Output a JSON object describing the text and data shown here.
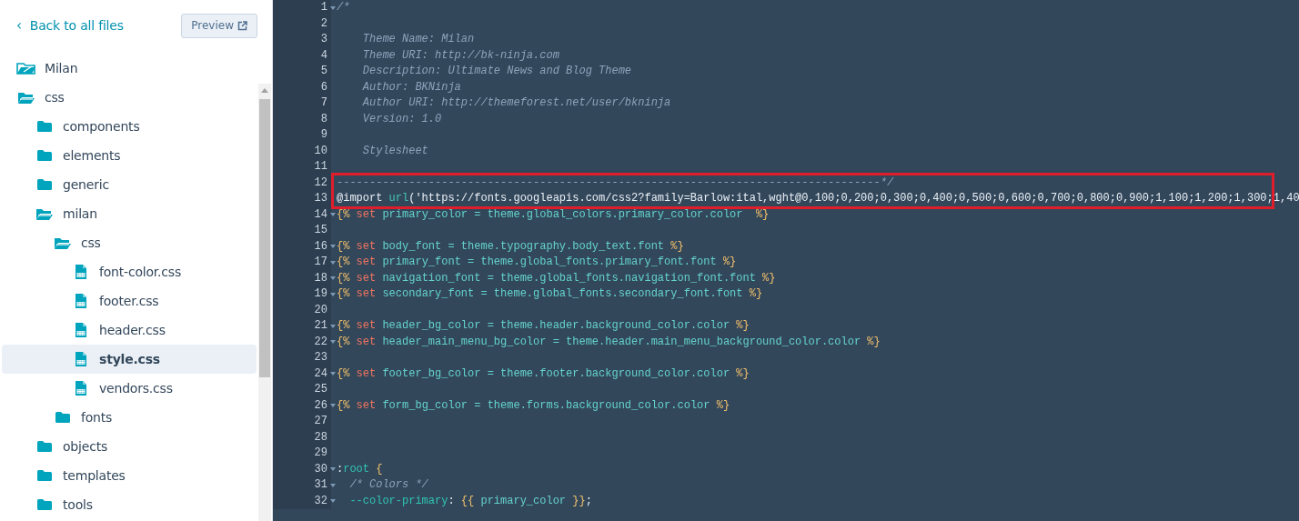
{
  "sidebar": {
    "back_link": {
      "icon": "‹",
      "label": "Back to all files"
    },
    "preview_button": {
      "label": "Preview"
    },
    "tree": [
      {
        "kind": "theme",
        "label": "Milan",
        "selected": false
      },
      {
        "kind": "folder",
        "label": "css",
        "expanded": true,
        "selected": false,
        "children": [
          {
            "kind": "folder",
            "label": "components",
            "expanded": false,
            "selected": false
          },
          {
            "kind": "folder",
            "label": "elements",
            "expanded": false,
            "selected": false
          },
          {
            "kind": "folder",
            "label": "generic",
            "expanded": false,
            "selected": false
          },
          {
            "kind": "folder",
            "label": "milan",
            "expanded": true,
            "selected": false,
            "children": [
              {
                "kind": "folder",
                "label": "css",
                "expanded": true,
                "selected": false,
                "children": [
                  {
                    "kind": "file",
                    "label": "font-color.css",
                    "selected": false
                  },
                  {
                    "kind": "file",
                    "label": "footer.css",
                    "selected": false
                  },
                  {
                    "kind": "file",
                    "label": "header.css",
                    "selected": false
                  },
                  {
                    "kind": "file",
                    "label": "style.css",
                    "selected": true
                  },
                  {
                    "kind": "file",
                    "label": "vendors.css",
                    "selected": false
                  }
                ]
              },
              {
                "kind": "folder",
                "label": "fonts",
                "expanded": false,
                "selected": false
              }
            ]
          },
          {
            "kind": "folder",
            "label": "objects",
            "expanded": false,
            "selected": false
          },
          {
            "kind": "folder",
            "label": "templates",
            "expanded": false,
            "selected": false
          },
          {
            "kind": "folder",
            "label": "tools",
            "expanded": false,
            "selected": false
          }
        ]
      }
    ]
  },
  "editor": {
    "lines": [
      {
        "number": "1",
        "foldable": true,
        "highlighted": false,
        "tokens": [
          {
            "kind": "comment",
            "text": "/*"
          }
        ]
      },
      {
        "number": "2",
        "foldable": false,
        "highlighted": false
      },
      {
        "number": "3",
        "foldable": false,
        "highlighted": false,
        "tokens": [
          {
            "kind": "comment",
            "text": "    Theme Name: Milan"
          }
        ]
      },
      {
        "number": "4",
        "foldable": false,
        "highlighted": false,
        "tokens": [
          {
            "kind": "comment",
            "text": "    Theme URI: http://bk-ninja.com"
          }
        ]
      },
      {
        "number": "5",
        "foldable": false,
        "highlighted": false,
        "tokens": [
          {
            "kind": "comment",
            "text": "    Description: Ultimate News and Blog Theme"
          }
        ]
      },
      {
        "number": "6",
        "foldable": false,
        "highlighted": false,
        "tokens": [
          {
            "kind": "comment",
            "text": "    Author: BKNinja"
          }
        ]
      },
      {
        "number": "7",
        "foldable": false,
        "highlighted": false,
        "tokens": [
          {
            "kind": "comment",
            "text": "    Author URI: http://themeforest.net/user/bkninja"
          }
        ]
      },
      {
        "number": "8",
        "foldable": false,
        "highlighted": false,
        "tokens": [
          {
            "kind": "comment",
            "text": "    Version: 1.0"
          }
        ]
      },
      {
        "number": "9",
        "foldable": false,
        "highlighted": false
      },
      {
        "number": "10",
        "foldable": false,
        "highlighted": false,
        "tokens": [
          {
            "kind": "comment",
            "text": "    Stylesheet"
          }
        ]
      },
      {
        "number": "11",
        "foldable": false,
        "highlighted": false
      },
      {
        "number": "12",
        "foldable": false,
        "highlighted": true,
        "tokens": [
          {
            "kind": "comment",
            "text": "-----------------------------------------------------------------------------------*/"
          }
        ]
      },
      {
        "number": "13",
        "foldable": false,
        "highlighted": true,
        "tokens": [
          {
            "kind": "plain",
            "text": "@import "
          },
          {
            "kind": "func",
            "text": "url"
          },
          {
            "kind": "plain",
            "text": "('https://fonts.googleapis.com/css2?family=Barlow:ital,wght@0,100;0,200;0,300;0,400;0,500;0,600;0,700;0,800;0,900;1,100;1,200;1,300;1,40"
          }
        ]
      },
      {
        "number": "14",
        "foldable": true,
        "highlighted": false,
        "tokens": [
          {
            "kind": "delim",
            "text": "{%"
          },
          {
            "kind": "set",
            "text": " set "
          },
          {
            "kind": "var",
            "text": "primary_color = theme.global_colors.primary_color.color  "
          },
          {
            "kind": "delim",
            "text": "%}"
          }
        ]
      },
      {
        "number": "15",
        "foldable": false,
        "highlighted": false
      },
      {
        "number": "16",
        "foldable": true,
        "highlighted": false,
        "tokens": [
          {
            "kind": "delim",
            "text": "{%"
          },
          {
            "kind": "set",
            "text": " set "
          },
          {
            "kind": "var",
            "text": "body_font = theme.typography.body_text.font "
          },
          {
            "kind": "delim",
            "text": "%}"
          }
        ]
      },
      {
        "number": "17",
        "foldable": true,
        "highlighted": false,
        "tokens": [
          {
            "kind": "delim",
            "text": "{%"
          },
          {
            "kind": "set",
            "text": " set "
          },
          {
            "kind": "var",
            "text": "primary_font = theme.global_fonts.primary_font.font "
          },
          {
            "kind": "delim",
            "text": "%}"
          }
        ]
      },
      {
        "number": "18",
        "foldable": true,
        "highlighted": false,
        "tokens": [
          {
            "kind": "delim",
            "text": "{%"
          },
          {
            "kind": "set",
            "text": " set "
          },
          {
            "kind": "var",
            "text": "navigation_font = theme.global_fonts.navigation_font.font "
          },
          {
            "kind": "delim",
            "text": "%}"
          }
        ]
      },
      {
        "number": "19",
        "foldable": true,
        "highlighted": false,
        "tokens": [
          {
            "kind": "delim",
            "text": "{%"
          },
          {
            "kind": "set",
            "text": " set "
          },
          {
            "kind": "var",
            "text": "secondary_font = theme.global_fonts.secondary_font.font "
          },
          {
            "kind": "delim",
            "text": "%}"
          }
        ]
      },
      {
        "number": "20",
        "foldable": false,
        "highlighted": false
      },
      {
        "number": "21",
        "foldable": true,
        "highlighted": false,
        "tokens": [
          {
            "kind": "delim",
            "text": "{%"
          },
          {
            "kind": "set",
            "text": " set "
          },
          {
            "kind": "var",
            "text": "header_bg_color = theme.header.background_color.color "
          },
          {
            "kind": "delim",
            "text": "%}"
          }
        ]
      },
      {
        "number": "22",
        "foldable": true,
        "highlighted": false,
        "tokens": [
          {
            "kind": "delim",
            "text": "{%"
          },
          {
            "kind": "set",
            "text": " set "
          },
          {
            "kind": "var",
            "text": "header_main_menu_bg_color = theme.header.main_menu_background_color.color "
          },
          {
            "kind": "delim",
            "text": "%}"
          }
        ]
      },
      {
        "number": "23",
        "foldable": false,
        "highlighted": false
      },
      {
        "number": "24",
        "foldable": true,
        "highlighted": false,
        "tokens": [
          {
            "kind": "delim",
            "text": "{%"
          },
          {
            "kind": "set",
            "text": " set "
          },
          {
            "kind": "var",
            "text": "footer_bg_color = theme.footer.background_color.color "
          },
          {
            "kind": "delim",
            "text": "%}"
          }
        ]
      },
      {
        "number": "25",
        "foldable": false,
        "highlighted": false
      },
      {
        "number": "26",
        "foldable": true,
        "highlighted": false,
        "tokens": [
          {
            "kind": "delim",
            "text": "{%"
          },
          {
            "kind": "set",
            "text": " set "
          },
          {
            "kind": "var",
            "text": "form_bg_color = theme.forms.background_color.color "
          },
          {
            "kind": "delim",
            "text": "%}"
          }
        ]
      },
      {
        "number": "27",
        "foldable": false,
        "highlighted": false
      },
      {
        "number": "28",
        "foldable": false,
        "highlighted": false
      },
      {
        "number": "29",
        "foldable": false,
        "highlighted": false
      },
      {
        "number": "30",
        "foldable": true,
        "highlighted": false,
        "tokens": [
          {
            "kind": "plain",
            "text": ":"
          },
          {
            "kind": "selector",
            "text": "root"
          },
          {
            "kind": "delim",
            "text": " {"
          }
        ]
      },
      {
        "number": "31",
        "foldable": true,
        "highlighted": false,
        "tokens": [
          {
            "kind": "comment",
            "text": "  /* Colors */"
          }
        ]
      },
      {
        "number": "32",
        "foldable": true,
        "highlighted": false,
        "tokens": [
          {
            "kind": "selector",
            "text": "  --color-primary"
          },
          {
            "kind": "plain",
            "text": ": "
          },
          {
            "kind": "delim",
            "text": "{{"
          },
          {
            "kind": "var",
            "text": " primary_color "
          },
          {
            "kind": "delim",
            "text": "}}"
          },
          {
            "kind": "plain",
            "text": ";"
          }
        ]
      }
    ]
  }
}
